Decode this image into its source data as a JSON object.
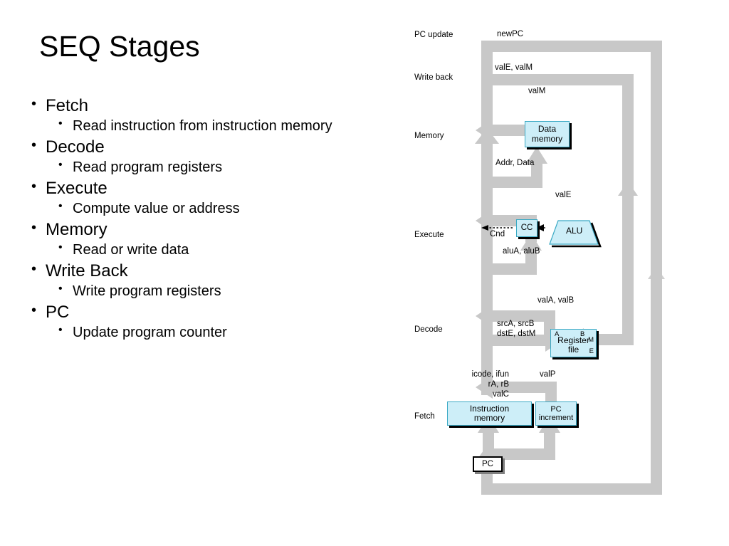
{
  "slide": {
    "title": "SEQ Stages",
    "bullets": [
      {
        "heading": "Fetch",
        "sub": "Read instruction from instruction memory"
      },
      {
        "heading": "Decode",
        "sub": "Read program registers"
      },
      {
        "heading": "Execute",
        "sub": "Compute value or address"
      },
      {
        "heading": "Memory",
        "sub": "Read or write data"
      },
      {
        "heading": "Write Back",
        "sub": "Write program registers"
      },
      {
        "heading": "PC",
        "sub": "Update program counter"
      }
    ]
  },
  "diagram": {
    "stage_labels": [
      {
        "text": "PC update"
      },
      {
        "text": "Write back"
      },
      {
        "text": "Memory"
      },
      {
        "text": "Execute"
      },
      {
        "text": "Decode"
      },
      {
        "text": "Fetch"
      }
    ],
    "signals": [
      {
        "text": "newPC"
      },
      {
        "text": "valE, valM"
      },
      {
        "text": "valM"
      },
      {
        "text": "Addr, Data"
      },
      {
        "text": "valE"
      },
      {
        "text": "Cnd"
      },
      {
        "text": "aluA, aluB"
      },
      {
        "text": "valA, valB"
      },
      {
        "text": "srcA, srcB"
      },
      {
        "text": "dstE, dstM"
      },
      {
        "text": "icode, ifun"
      },
      {
        "text": "rA, rB"
      },
      {
        "text": "valC"
      },
      {
        "text": "valP"
      }
    ],
    "units": [
      {
        "name": "data-memory",
        "line1": "Data",
        "line2": "memory"
      },
      {
        "name": "cc-register",
        "line1": "CC",
        "line2": ""
      },
      {
        "name": "alu",
        "line1": "ALU",
        "line2": ""
      },
      {
        "name": "register-file",
        "line1": "Register",
        "line2": "file"
      },
      {
        "name": "instruction-memory",
        "line1": "Instruction",
        "line2": "memory"
      },
      {
        "name": "pc-increment",
        "line1": "PC",
        "line2": "increment"
      },
      {
        "name": "pc-register",
        "line1": "PC",
        "line2": ""
      }
    ],
    "register_ports": [
      {
        "text": "A"
      },
      {
        "text": "B"
      },
      {
        "text": "M"
      },
      {
        "text": "E"
      }
    ],
    "colors": {
      "bus": "#c8c8c8",
      "unit_fill": "#cdeef8",
      "unit_border": "#3aa9c4",
      "background": "#ffffff"
    }
  }
}
